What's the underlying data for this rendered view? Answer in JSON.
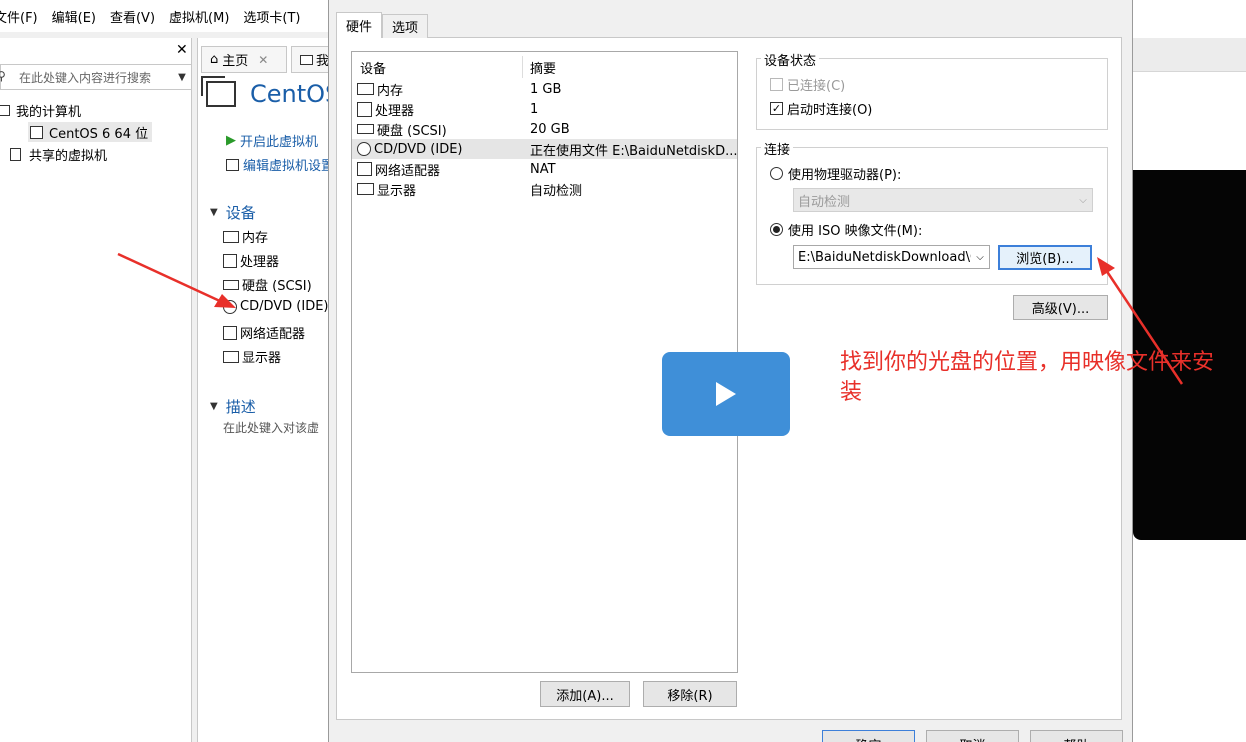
{
  "menubar": {
    "items": [
      "文件(F)",
      "编辑(E)",
      "查看(V)",
      "虚拟机(M)",
      "选项卡(T)"
    ]
  },
  "library": {
    "search_placeholder": "在此处键入内容进行搜索",
    "tree": [
      "我的计算机",
      "CentOS 6 64 位",
      "共享的虚拟机"
    ]
  },
  "tabs": {
    "home": "主页",
    "second": "我"
  },
  "vm": {
    "title": "CentOS",
    "power_on": "开启此虚拟机",
    "edit_settings": "编辑虚拟机设置",
    "devices_header": "设备",
    "devices": [
      "内存",
      "处理器",
      "硬盘 (SCSI)",
      "CD/DVD (IDE)",
      "网络适配器",
      "显示器"
    ],
    "description_header": "描述",
    "description_placeholder": "在此处键入对该虚"
  },
  "dialog": {
    "tabs": [
      "硬件",
      "选项"
    ],
    "table_headers": [
      "设备",
      "摘要"
    ],
    "rows": [
      {
        "device": "内存",
        "summary": "1 GB"
      },
      {
        "device": "处理器",
        "summary": "1"
      },
      {
        "device": "硬盘 (SCSI)",
        "summary": "20 GB"
      },
      {
        "device": "CD/DVD (IDE)",
        "summary": "正在使用文件 E:\\BaiduNetdiskD..."
      },
      {
        "device": "网络适配器",
        "summary": "NAT"
      },
      {
        "device": "显示器",
        "summary": "自动检测"
      }
    ],
    "add_button": "添加(A)...",
    "remove_button": "移除(R)",
    "device_status": {
      "title": "设备状态",
      "connected": "已连接(C)",
      "connect_on_power": "启动时连接(O)"
    },
    "connection": {
      "title": "连接",
      "physical": "使用物理驱动器(P):",
      "physical_value": "自动检测",
      "iso": "使用 ISO 映像文件(M):",
      "iso_value": "E:\\BaiduNetdiskDownload\\Ce",
      "browse": "浏览(B)..."
    },
    "advanced": "高级(V)...",
    "footer": [
      "确定",
      "取消",
      "帮助"
    ]
  },
  "annotation": "找到你的光盘的位置，用映像文件来安装",
  "colors": {
    "accent": "#1a5ea8",
    "annotation": "#e8302a",
    "play": "#3f8fd8"
  }
}
